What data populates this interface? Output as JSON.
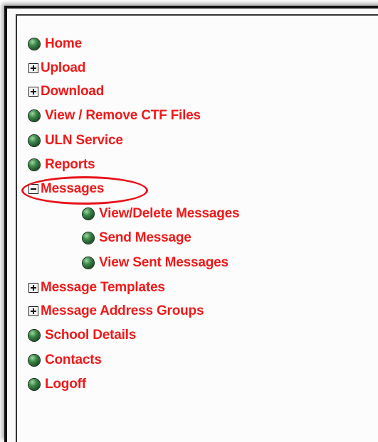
{
  "menu": {
    "items": [
      {
        "label": "Home",
        "icon": "bullet-icon"
      },
      {
        "label": "Upload",
        "icon": "expand-plus-icon"
      },
      {
        "label": "Download",
        "icon": "expand-plus-icon"
      },
      {
        "label": "View / Remove CTF Files",
        "icon": "bullet-icon"
      },
      {
        "label": "ULN Service",
        "icon": "bullet-icon"
      },
      {
        "label": "Reports",
        "icon": "bullet-icon"
      },
      {
        "label": "Messages",
        "icon": "collapse-minus-icon",
        "expanded": true
      },
      {
        "label": "View/Delete Messages",
        "icon": "bullet-icon",
        "submenu_of": "Messages"
      },
      {
        "label": "Send Message",
        "icon": "bullet-icon",
        "submenu_of": "Messages"
      },
      {
        "label": "View Sent Messages",
        "icon": "bullet-icon",
        "submenu_of": "Messages"
      },
      {
        "label": "Message Templates",
        "icon": "expand-plus-icon"
      },
      {
        "label": "Message Address Groups",
        "icon": "expand-plus-icon"
      },
      {
        "label": "School Details",
        "icon": "bullet-icon"
      },
      {
        "label": "Contacts",
        "icon": "bullet-icon"
      },
      {
        "label": "Logoff",
        "icon": "bullet-icon"
      }
    ]
  },
  "colors": {
    "link": "#ee1a1a",
    "bullet": "#2f6b3a",
    "highlight_ring": "#e8121b",
    "border": "#111111"
  }
}
